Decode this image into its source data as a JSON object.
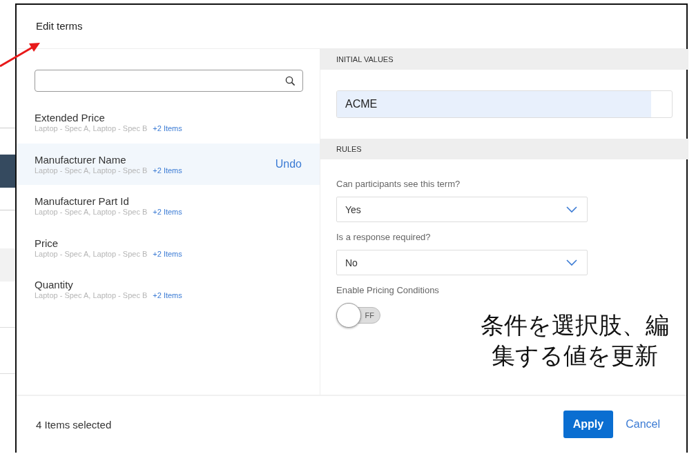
{
  "dialog": {
    "title": "Edit terms"
  },
  "terms": [
    {
      "name": "Extended Price",
      "items": "Laptop - Spec A, Laptop - Spec B",
      "more": "+2 Items",
      "selected": false
    },
    {
      "name": "Manufacturer Name",
      "items": "Laptop - Spec A, Laptop - Spec B",
      "more": "+2 Items",
      "selected": true,
      "action": "Undo"
    },
    {
      "name": "Manufacturer Part Id",
      "items": "Laptop - Spec A, Laptop - Spec B",
      "more": "+2 Items",
      "selected": false
    },
    {
      "name": "Price",
      "items": "Laptop - Spec A, Laptop - Spec B",
      "more": "+2 Items",
      "selected": false
    },
    {
      "name": "Quantity",
      "items": "Laptop - Spec A, Laptop - Spec B",
      "more": "+2 Items",
      "selected": false
    }
  ],
  "initial_values": {
    "heading": "INITIAL VALUES",
    "value": "ACME"
  },
  "rules": {
    "heading": "RULES",
    "fields": [
      {
        "kind": "select",
        "label": "Can participants see this term?",
        "value": "Yes"
      },
      {
        "kind": "select",
        "label": "Is a response required?",
        "value": "No"
      },
      {
        "kind": "toggle",
        "label": "Enable Pricing Conditions",
        "state_text": "FF",
        "on": false
      }
    ]
  },
  "annotation": {
    "text": "条件を選択肢、編集する値を更新"
  },
  "footer": {
    "status": "4 Items selected",
    "buttons": [
      {
        "kind": "primary",
        "label": "Apply"
      },
      {
        "kind": "link",
        "label": "Cancel"
      }
    ]
  }
}
